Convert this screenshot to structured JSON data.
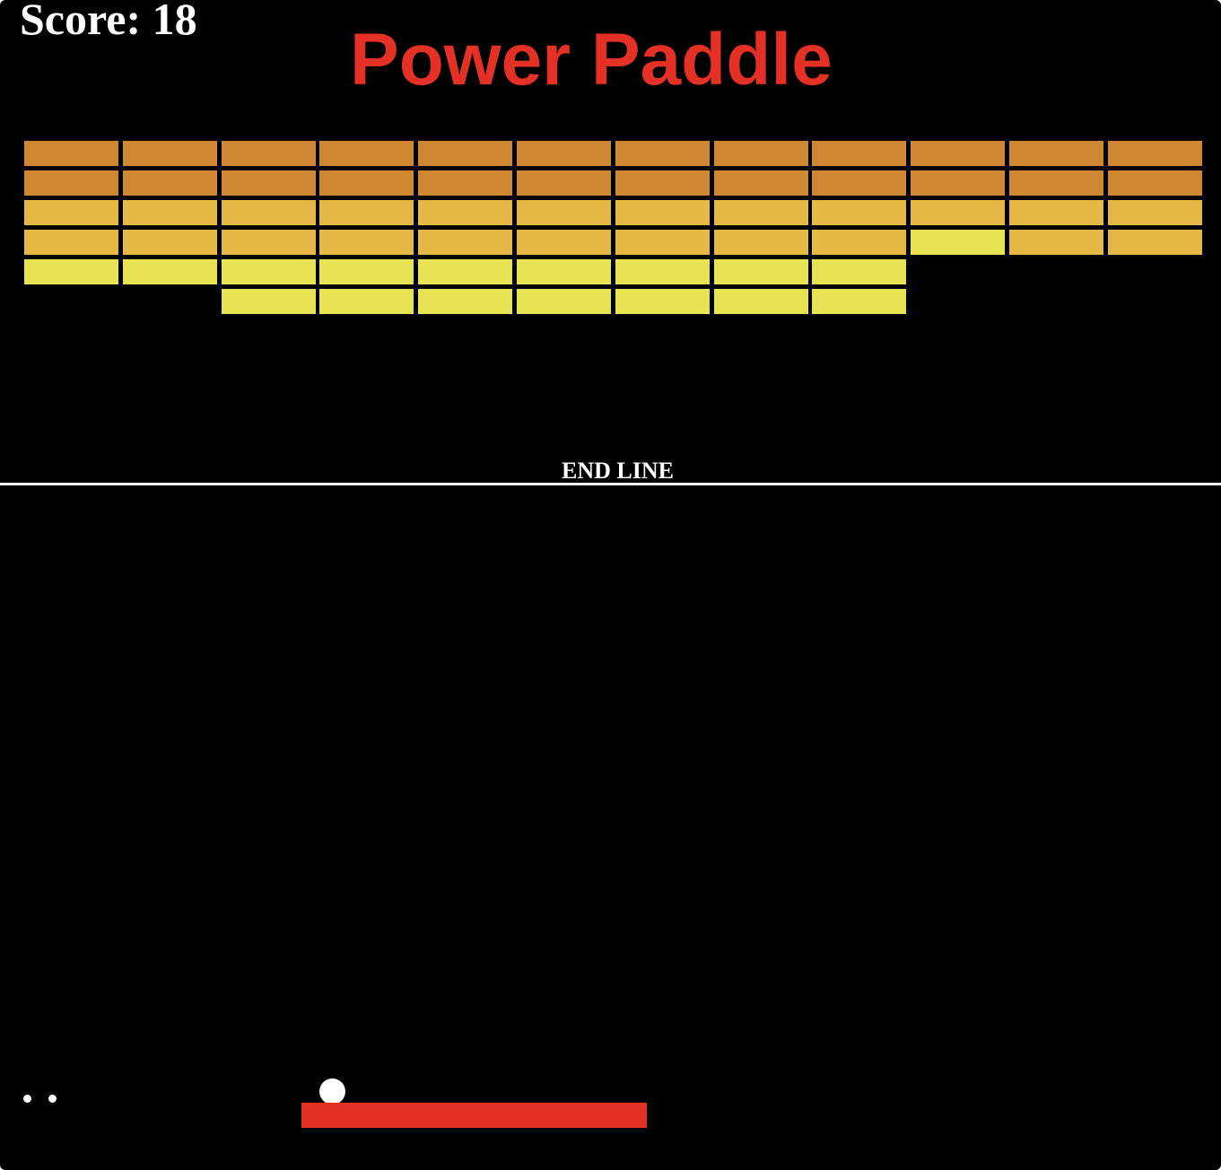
{
  "hud": {
    "score_text": "Score: 18",
    "score": 18,
    "title": "Power Paddle",
    "title_color": "#e53026"
  },
  "end_line": {
    "label": "END LINE",
    "color": "#ffffff"
  },
  "bricks": {
    "columns": 12,
    "rows": 6,
    "colors": {
      "orange": "#d08732",
      "amber": "#e6b845",
      "yellow": "#e8e352"
    },
    "grid": [
      [
        "orange",
        "orange",
        "orange",
        "orange",
        "orange",
        "orange",
        "orange",
        "orange",
        "orange",
        "orange",
        "orange",
        "orange"
      ],
      [
        "orange",
        "orange",
        "orange",
        "orange",
        "orange",
        "orange",
        "orange",
        "orange",
        "orange",
        "orange",
        "orange",
        "orange"
      ],
      [
        "amber",
        "amber",
        "amber",
        "amber",
        "amber",
        "amber",
        "amber",
        "amber",
        "amber",
        "amber",
        "amber",
        "amber"
      ],
      [
        "amber",
        "amber",
        "amber",
        "amber",
        "amber",
        "amber",
        "amber",
        "amber",
        "amber",
        "yellow",
        "amber",
        "amber"
      ],
      [
        "yellow",
        "yellow",
        "yellow",
        "yellow",
        "yellow",
        "yellow",
        "yellow",
        "yellow",
        "yellow",
        null,
        null,
        null
      ],
      [
        null,
        null,
        "yellow",
        "yellow",
        "yellow",
        "yellow",
        "yellow",
        "yellow",
        "yellow",
        null,
        null,
        null
      ]
    ]
  },
  "lives": {
    "count": 2,
    "icon": "life-dot-icon"
  },
  "ball": {
    "color": "#ffffff"
  },
  "paddle": {
    "color": "#e53026"
  },
  "background_color": "#000000"
}
